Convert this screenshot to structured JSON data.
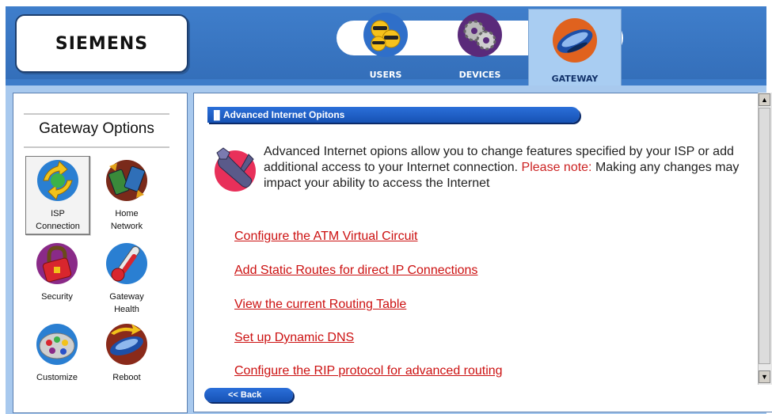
{
  "brand": {
    "logo": "SIEMENS"
  },
  "nav": {
    "tabs": [
      {
        "label": "USERS",
        "icon": "users-icon"
      },
      {
        "label": "DEVICES",
        "icon": "devices-gears-icon"
      },
      {
        "label": "GATEWAY",
        "icon": "gateway-router-icon",
        "active": true
      }
    ]
  },
  "sidebar": {
    "title": "Gateway Options",
    "options": [
      {
        "label": "ISP Connection",
        "line1": "ISP",
        "line2": "Connection",
        "icon": "isp-connection-icon",
        "selected": true
      },
      {
        "label": "Home Network",
        "line1": "Home",
        "line2": "Network",
        "icon": "home-network-icon"
      },
      {
        "label": "Security",
        "line1": "Security",
        "line2": "",
        "icon": "security-lock-icon"
      },
      {
        "label": "Gateway Health",
        "line1": "Gateway",
        "line2": "Health",
        "icon": "thermometer-icon"
      },
      {
        "label": "Customize",
        "line1": "Customize",
        "line2": "",
        "icon": "palette-icon"
      },
      {
        "label": "Reboot",
        "line1": "Reboot",
        "line2": "",
        "icon": "reboot-router-icon"
      }
    ]
  },
  "main": {
    "section_title": "Advanced Internet Opitons",
    "intro_text": "Advanced Internet opions allow you to change features specified by your ISP or add additional access to your Internet connection.",
    "note_label": "Please note:",
    "note_text": "Making any changes may impact your ability to access the Internet",
    "links": [
      "Configure the ATM Virtual Circuit",
      "Add Static Routes for direct IP Connections",
      "View the current Routing Table",
      "Set up Dynamic DNS",
      "Configure the RIP protocol for advanced routing"
    ]
  },
  "footer": {
    "back_label": "<< Back"
  },
  "colors": {
    "banner": "#3d7cc9",
    "frame": "#a8c9ee",
    "link": "#cc1111",
    "header_bar": "#1f5fc8"
  }
}
